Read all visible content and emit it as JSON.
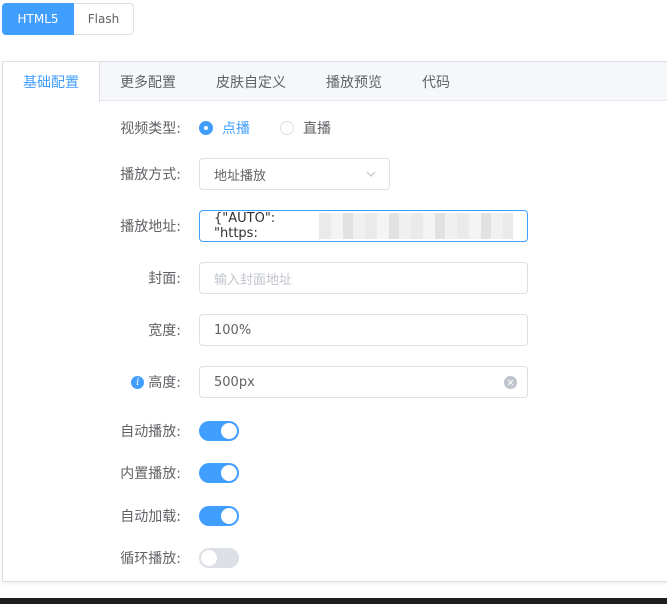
{
  "player_mode": {
    "html5": "HTML5",
    "flash": "Flash"
  },
  "tabs": [
    {
      "label": "基础配置",
      "active": true
    },
    {
      "label": "更多配置"
    },
    {
      "label": "皮肤自定义"
    },
    {
      "label": "播放预览"
    },
    {
      "label": "代码"
    }
  ],
  "form": {
    "video_type": {
      "label": "视频类型:",
      "options": [
        "点播",
        "直播"
      ],
      "selected": "点播"
    },
    "play_mode": {
      "label": "播放方式:",
      "value": "地址播放"
    },
    "play_url": {
      "label": "播放地址:",
      "value": "{\"AUTO\": \"https:"
    },
    "cover": {
      "label": "封面:",
      "placeholder": "输入封面地址"
    },
    "width": {
      "label": "宽度:",
      "value": "100%"
    },
    "height": {
      "label": "高度:",
      "value": "500px"
    },
    "autoplay": {
      "label": "自动播放:",
      "on": true
    },
    "inline_play": {
      "label": "内置播放:",
      "on": true
    },
    "autoload": {
      "label": "自动加载:",
      "on": true
    },
    "loop": {
      "label": "循环播放:",
      "on": false
    }
  },
  "colors": {
    "accent": "#409eff",
    "border": "#dcdfe6",
    "text": "#606266"
  },
  "icons": {
    "radio": "radio-icon",
    "select_chevron": "chevron-down-icon",
    "info": "info-icon",
    "clear": "clear-icon"
  }
}
